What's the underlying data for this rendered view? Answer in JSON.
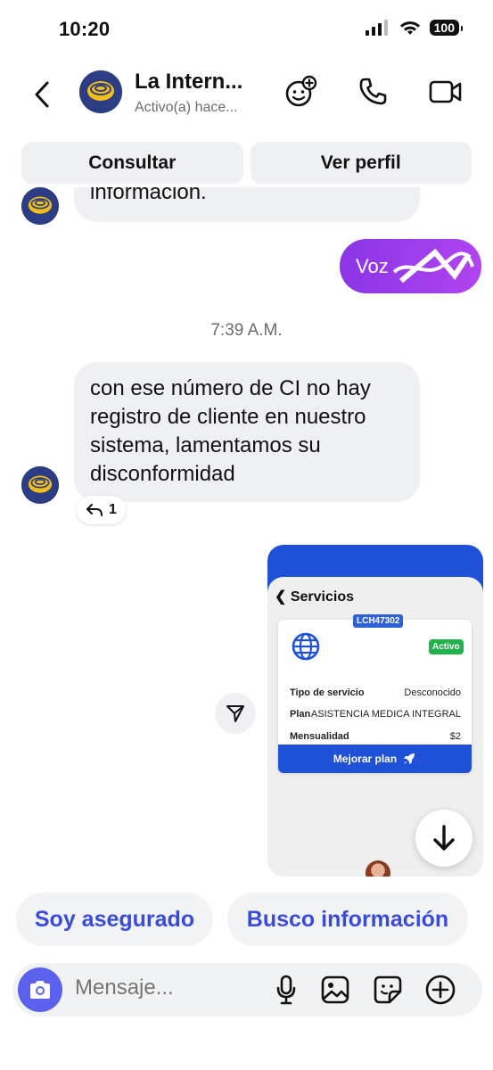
{
  "status": {
    "time": "10:20",
    "battery": "100"
  },
  "header": {
    "title": "La Intern...",
    "subtitle": "Activo(a) hace..."
  },
  "quick_actions": [
    "Consultar",
    "Ver perfil"
  ],
  "chat": {
    "partial_message": "información.",
    "outgoing_voice_label": "Voz",
    "timestamp": "7:39 A.M.",
    "incoming_message": "con ese número de CI no hay registro de cliente en nuestro sistema, lamentamos su disconformidad",
    "reaction_count": "1",
    "attachment": {
      "screen_title": "Servicios",
      "service_code": "LCH47302",
      "status_badge": "Activo",
      "rows": [
        {
          "label": "Tipo de servicio",
          "value": "Desconocido"
        },
        {
          "label": "Plan",
          "value": "ASISTENCIA MEDICA INTEGRAL"
        },
        {
          "label": "Mensualidad",
          "value": "$2"
        }
      ],
      "cta": "Mejorar plan"
    }
  },
  "suggestions": [
    "Soy asegurado",
    "Busco información"
  ],
  "composer": {
    "placeholder": "Mensaje..."
  },
  "colors": {
    "accent": "#5b61ec",
    "link": "#3a4bdc",
    "bubble_out": "#8a35e6",
    "attachment_blue": "#1f50d8",
    "active_green": "#22b14c"
  }
}
